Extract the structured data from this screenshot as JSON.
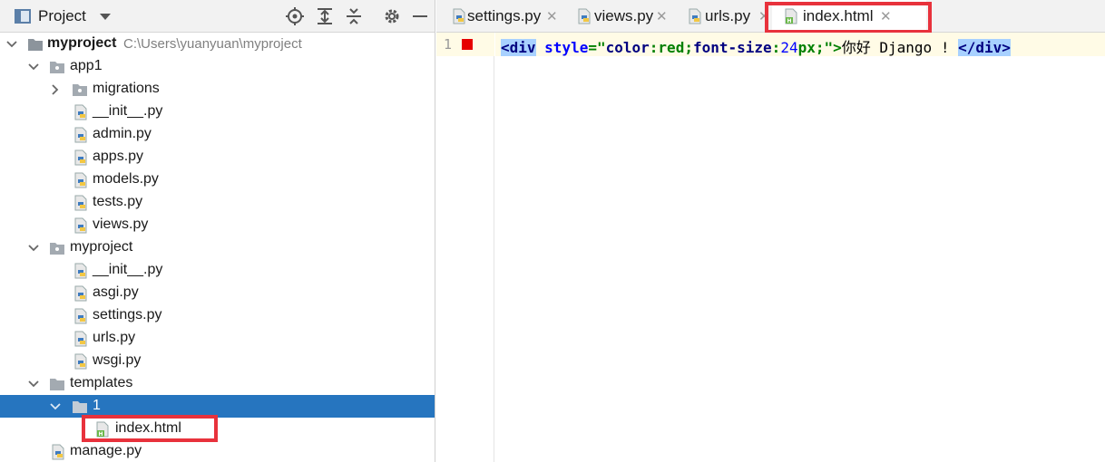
{
  "panel": {
    "title": "Project",
    "icons": [
      "project-icon",
      "locate-icon",
      "expand-all-icon",
      "collapse-all-icon",
      "gear-icon",
      "minimize-icon"
    ]
  },
  "tree": {
    "root": {
      "label": "myproject",
      "path": "C:\\Users\\yuanyuan\\myproject"
    },
    "app1": {
      "label": "app1",
      "children": [
        "migrations",
        "__init__.py",
        "admin.py",
        "apps.py",
        "models.py",
        "tests.py",
        "views.py"
      ]
    },
    "pkg": {
      "label": "myproject",
      "children": [
        "__init__.py",
        "asgi.py",
        "settings.py",
        "urls.py",
        "wsgi.py"
      ]
    },
    "templates": {
      "label": "templates",
      "folder1": "1",
      "file": "index.html"
    },
    "manage": "manage.py"
  },
  "tabs": [
    {
      "label": "settings.py",
      "close": "✕",
      "icon": "python-file-icon"
    },
    {
      "label": "views.py",
      "close": "✕",
      "icon": "python-file-icon"
    },
    {
      "label": "urls.py",
      "close": "✕",
      "icon": "python-file-icon"
    },
    {
      "label": "index.html",
      "close": "✕",
      "icon": "html-file-icon",
      "active": true
    }
  ],
  "editor": {
    "line_number": "1",
    "code": {
      "open_tag": "<div",
      "attr": "style",
      "eq_quote": "=\"",
      "p1": "color",
      "colon1": ":",
      "v1": "red",
      "semi1": ";",
      "p2": "font-size",
      "colon2": ":",
      "v2num": "24",
      "v2unit": "px",
      "semi2": ";",
      "close_quote": "\">",
      "text": "你好 Django ! ",
      "close_tag": "</div>"
    }
  },
  "colors": {
    "selection": "#2675bf",
    "highlight_box": "#e8323c",
    "breakpoint": "#e60000"
  }
}
